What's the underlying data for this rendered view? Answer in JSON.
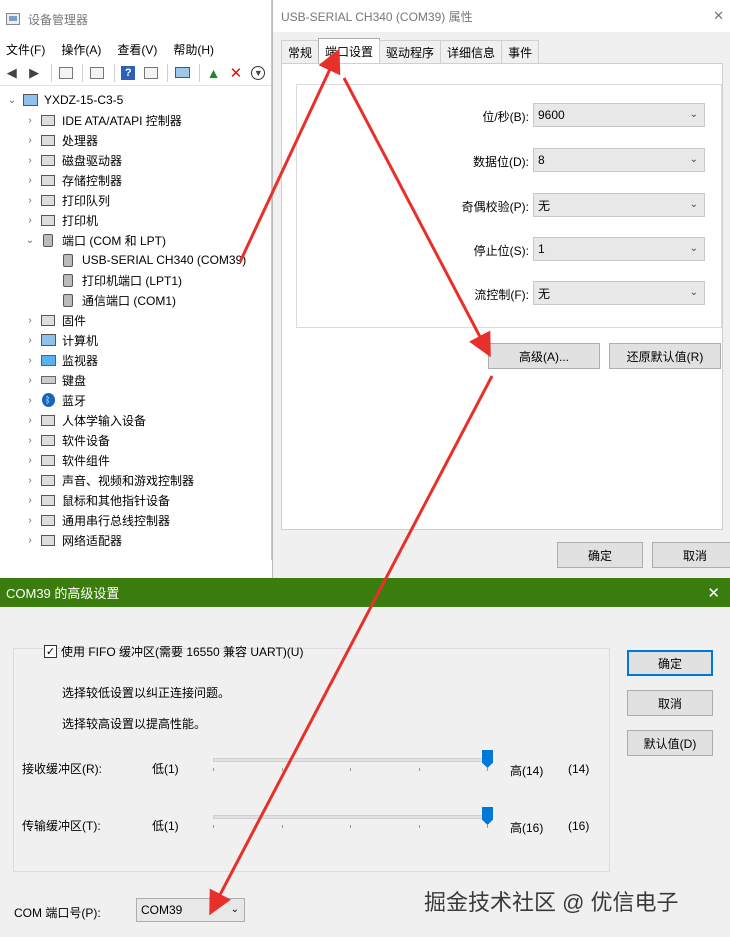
{
  "device_manager": {
    "title": "设备管理器",
    "menu": [
      "文件(F)",
      "操作(A)",
      "查看(V)",
      "帮助(H)"
    ],
    "tree": {
      "root": "YXDZ-15-C3-5",
      "items": [
        {
          "label": "IDE ATA/ATAPI 控制器",
          "icon": "ide-controller-icon"
        },
        {
          "label": "处理器",
          "icon": "processor-icon"
        },
        {
          "label": "磁盘驱动器",
          "icon": "disk-drive-icon"
        },
        {
          "label": "存储控制器",
          "icon": "storage-controller-icon"
        },
        {
          "label": "打印队列",
          "icon": "print-queue-icon"
        },
        {
          "label": "打印机",
          "icon": "printer-icon"
        },
        {
          "label": "端口 (COM 和 LPT)",
          "icon": "port-icon",
          "expanded": true,
          "children": [
            "USB-SERIAL CH340 (COM39)",
            "打印机端口 (LPT1)",
            "通信端口 (COM1)"
          ]
        },
        {
          "label": "固件",
          "icon": "firmware-icon"
        },
        {
          "label": "计算机",
          "icon": "computer-icon"
        },
        {
          "label": "监视器",
          "icon": "monitor-icon"
        },
        {
          "label": "键盘",
          "icon": "keyboard-icon"
        },
        {
          "label": "蓝牙",
          "icon": "bluetooth-icon"
        },
        {
          "label": "人体学输入设备",
          "icon": "hid-icon"
        },
        {
          "label": "软件设备",
          "icon": "software-device-icon"
        },
        {
          "label": "软件组件",
          "icon": "software-component-icon"
        },
        {
          "label": "声音、视频和游戏控制器",
          "icon": "sound-icon"
        },
        {
          "label": "鼠标和其他指针设备",
          "icon": "mouse-icon"
        },
        {
          "label": "通用串行总线控制器",
          "icon": "usb-icon"
        },
        {
          "label": "网络适配器",
          "icon": "network-adapter-icon"
        }
      ]
    }
  },
  "properties": {
    "title": "USB-SERIAL CH340 (COM39) 属性",
    "tabs": [
      "常规",
      "端口设置",
      "驱动程序",
      "详细信息",
      "事件"
    ],
    "active_tab": "端口设置",
    "fields": [
      {
        "label": "位/秒(B):",
        "value": "9600"
      },
      {
        "label": "数据位(D):",
        "value": "8"
      },
      {
        "label": "奇偶校验(P):",
        "value": "无"
      },
      {
        "label": "停止位(S):",
        "value": "1"
      },
      {
        "label": "流控制(F):",
        "value": "无"
      }
    ],
    "advanced_button": "高级(A)...",
    "restore_button": "还原默认值(R)",
    "ok_button": "确定",
    "cancel_button": "取消"
  },
  "advanced": {
    "title": "COM39 的高级设置",
    "fifo_label": "使用 FIFO 缓冲区(需要 16550 兼容 UART)(U)",
    "fifo_checked": true,
    "hint_low": "选择较低设置以纠正连接问题。",
    "hint_high": "选择较高设置以提高性能。",
    "receive": {
      "label": "接收缓冲区(R):",
      "low": "低(1)",
      "high": "高(14)",
      "current": "(14)",
      "value": 14,
      "max": 14
    },
    "transmit": {
      "label": "传输缓冲区(T):",
      "low": "低(1)",
      "high": "高(16)",
      "current": "(16)",
      "value": 16,
      "max": 16
    },
    "com_label": "COM 端口号(P):",
    "com_value": "COM39",
    "ok_button": "确定",
    "cancel_button": "取消",
    "defaults_button": "默认值(D)"
  },
  "watermark": "掘金技术社区 @ 优信电子",
  "colors": {
    "accent_green": "#3a7d0e",
    "annotation_red": "#e8302a",
    "focus_blue": "#0078d7"
  }
}
